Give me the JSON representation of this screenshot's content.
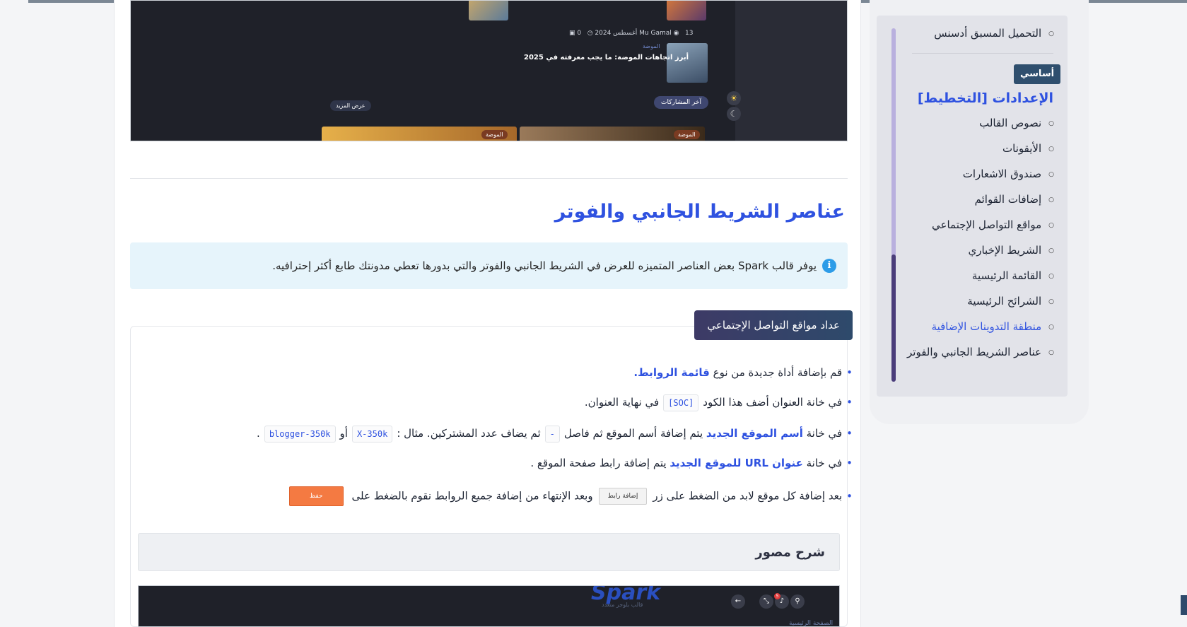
{
  "top_screenshot": {
    "post_meta": {
      "author": "Mu Gamal",
      "date": "13 أغسطس 2024",
      "comments": "0"
    },
    "post_category": "الموضة",
    "post_title": "أبرز اتجاهات الموضة: ما يجب معرفته في 2025",
    "latest_posts_label": "آخر المشاركات",
    "show_more_label": "عرض المزيد",
    "tag_label": "الموضة"
  },
  "section": {
    "title": "عناصر الشريط الجانبي والفوتر",
    "info": "يوفر قالب Spark بعض العناصر المتميزه للعرض في الشريط الجانبي والفوتر والتي بدورها تعطي مدونتك طابع أكثر إحترافيه."
  },
  "card": {
    "tab_label": "عداد مواقع التواصل الإجتماعي",
    "step1_pre": "قم بإضافة أداة جديدة من نوع ",
    "step1_link": "قائمة الروابط.",
    "step2_pre": "في خانة العنوان أضف هذا الكود",
    "step2_code": "[SOC]",
    "step2_post": "في نهاية العنوان.",
    "step3_pre": "في خانة ",
    "step3_link": "أسم الموقع الجديد",
    "step3_mid": " يتم إضافة أسم الموقع ثم فاصل",
    "step3_sep": "-",
    "step3_mid2": "ثم يضاف عدد المشتركين. مثال :",
    "step3_ex1": "X-350k",
    "step3_or": "أو",
    "step3_ex2": "blogger-350k",
    "step3_end": ".",
    "step4_pre": "في خانة ",
    "step4_link": "عنوان URL للموقع الجديد",
    "step4_post": " يتم إضافة رابط صفحة الموقع .",
    "step5_pre": "بعد إضافة كل موقع لابد من الضغط على زر",
    "step5_btn": "إضافة رابط",
    "step5_mid": "وبعد الإنتهاء من إضافة جميع الروابط نقوم بالضغط على",
    "step5_save": "حفظ",
    "explain_title": "شرح مصور"
  },
  "bottom_screenshot": {
    "logo": "Spark",
    "logo_sub": "قالب بلوجر متعدد",
    "home": "الصفحة الرئيسية",
    "badge": "5"
  },
  "toc": {
    "top_item": "التحميل المسبق أدسنس",
    "badge": "أساسي",
    "heading": "الإعدادات [التخطيط]",
    "items": [
      "نصوص القالب",
      "الأيقونات",
      "صندوق الاشعارات",
      "إضافات القوائم",
      "مواقع التواصل الإجتماعي",
      "الشريط الإخباري",
      "القائمة الرئيسية",
      "الشرائح الرئيسية",
      "منطقة التدوينات الإضافية",
      "عناصر الشريط الجانبي والفوتر"
    ]
  }
}
